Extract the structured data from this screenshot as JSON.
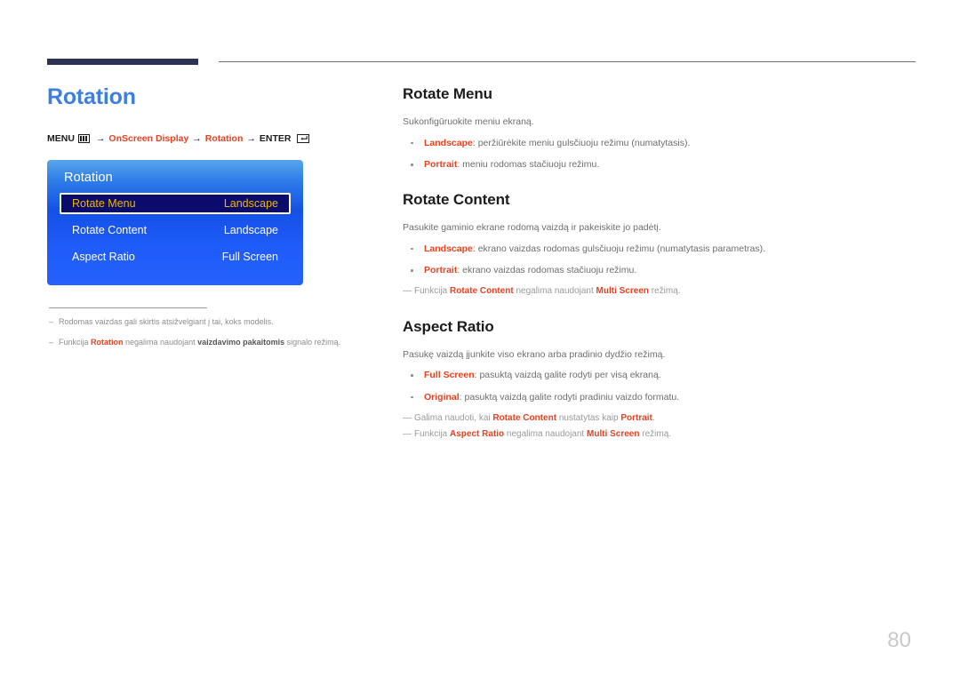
{
  "page": {
    "number": "80",
    "title": "Rotation"
  },
  "menu_path": {
    "menu_label": "MENU",
    "menu_icon": "menu-grid-icon",
    "arrow": "→",
    "step1": "OnScreen Display",
    "step2": "Rotation",
    "enter_label": "ENTER",
    "enter_icon": "enter-key-icon"
  },
  "osd": {
    "title": "Rotation",
    "rows": [
      {
        "label": "Rotate Menu",
        "value": "Landscape",
        "selected": true
      },
      {
        "label": "Rotate Content",
        "value": "Landscape",
        "selected": false
      },
      {
        "label": "Aspect Ratio",
        "value": "Full Screen",
        "selected": false
      }
    ]
  },
  "left_notes": [
    {
      "dash": "–",
      "parts": [
        {
          "t": "Rodomas vaizdas gali skirtis atsižvelgiant į tai, koks modelis.",
          "s": "plain"
        }
      ]
    },
    {
      "dash": "–",
      "parts": [
        {
          "t": "Funkcija ",
          "s": "plain"
        },
        {
          "t": "Rotation",
          "s": "red"
        },
        {
          "t": " negalima naudojant ",
          "s": "plain"
        },
        {
          "t": "vaizdavimo pakaitomis",
          "s": "bold"
        },
        {
          "t": " signalo režimą.",
          "s": "plain"
        }
      ]
    }
  ],
  "sections": [
    {
      "title": "Rotate Menu",
      "lead": "Sukonfigūruokite meniu ekraną.",
      "bullets": [
        {
          "key": "Landscape",
          "text": ": peržiūrėkite meniu gulsčiuoju režimu (numatytasis)."
        },
        {
          "key": "Portrait",
          "text": ": meniu rodomas stačiuoju režimu."
        }
      ],
      "notes": []
    },
    {
      "title": "Rotate Content",
      "lead": "Pasukite gaminio ekrane rodomą vaizdą ir pakeiskite jo padėtį.",
      "bullets": [
        {
          "key": "Landscape",
          "text": ": ekrano vaizdas rodomas gulsčiuoju režimu (numatytasis parametras)."
        },
        {
          "key": "Portrait",
          "text": ": ekrano vaizdas rodomas stačiuoju režimu."
        }
      ],
      "notes": [
        {
          "dash": "—",
          "parts": [
            {
              "t": "Funkcija ",
              "s": "plain"
            },
            {
              "t": "Rotate Content",
              "s": "red"
            },
            {
              "t": " negalima naudojant ",
              "s": "plain"
            },
            {
              "t": "Multi Screen",
              "s": "red"
            },
            {
              "t": " režimą.",
              "s": "plain"
            }
          ]
        }
      ]
    },
    {
      "title": "Aspect Ratio",
      "lead": "Pasukę vaizdą įjunkite viso ekrano arba pradinio dydžio režimą.",
      "bullets": [
        {
          "key": "Full Screen",
          "text": ": pasuktą vaizdą galite rodyti per visą ekraną."
        },
        {
          "key": "Original",
          "text": ": pasuktą vaizdą galite rodyti pradiniu vaizdo formatu."
        }
      ],
      "notes": [
        {
          "dash": "—",
          "parts": [
            {
              "t": "Galima naudoti, kai ",
              "s": "plain"
            },
            {
              "t": "Rotate Content",
              "s": "red"
            },
            {
              "t": " nustatytas kaip ",
              "s": "plain"
            },
            {
              "t": "Portrait",
              "s": "red"
            },
            {
              "t": ".",
              "s": "plain"
            }
          ]
        },
        {
          "dash": "—",
          "parts": [
            {
              "t": "Funkcija ",
              "s": "plain"
            },
            {
              "t": "Aspect Ratio",
              "s": "red"
            },
            {
              "t": " negalima naudojant ",
              "s": "plain"
            },
            {
              "t": "Multi Screen",
              "s": "red"
            },
            {
              "t": " režimą.",
              "s": "plain"
            }
          ]
        }
      ]
    }
  ],
  "colors": {
    "title_blue": "#3d7fe0",
    "accent_red": "#e8411f",
    "rule_navy": "#2e3356",
    "osd_selected_bg": "#0b0b6b",
    "osd_selected_text": "#edb800",
    "page_number_gray": "#c9c9c9"
  }
}
